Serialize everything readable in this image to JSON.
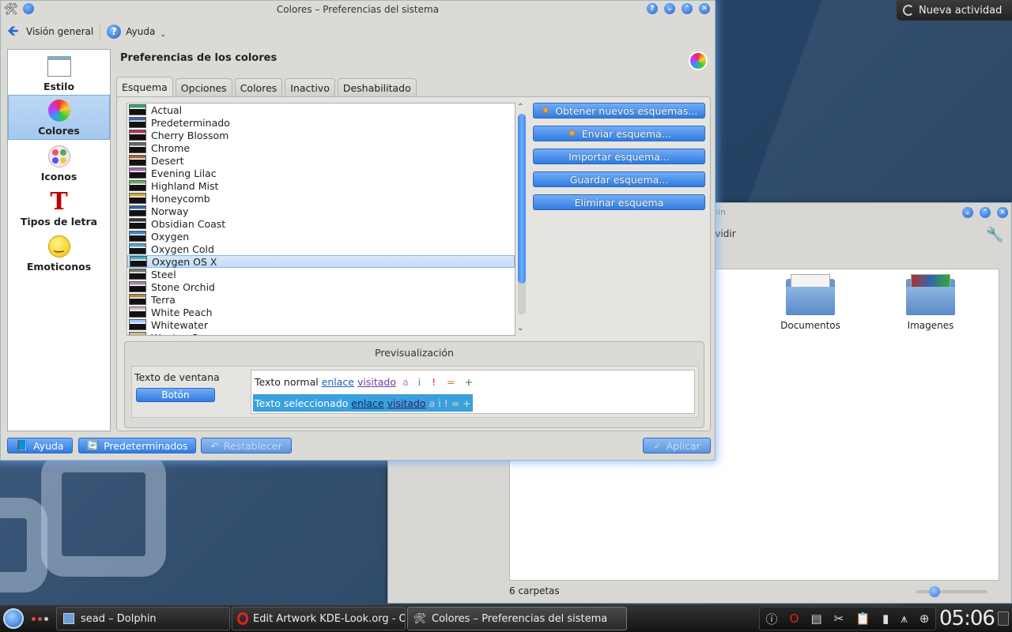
{
  "activity_button": {
    "label": "Nueva actividad"
  },
  "dolphin": {
    "title_partial": "hin",
    "split_label_partial": "ividir",
    "folders": [
      {
        "name": "Documentos"
      },
      {
        "name": "Imagenes"
      }
    ],
    "status": "6 carpetas"
  },
  "window": {
    "title": "Colores – Preferencias del sistema",
    "toolbar": {
      "overview_label": "Visión general",
      "help_label": "Ayuda"
    },
    "sidebar": {
      "items": [
        {
          "label": "Estilo",
          "icon": "style-icon",
          "selected": false
        },
        {
          "label": "Colores",
          "icon": "colors-icon",
          "selected": true
        },
        {
          "label": "Iconos",
          "icon": "icons-icon",
          "selected": false
        },
        {
          "label": "Tipos de letra",
          "icon": "fonts-icon",
          "selected": false
        },
        {
          "label": "Emoticonos",
          "icon": "emoticons-icon",
          "selected": false
        }
      ]
    },
    "heading": "Preferencias de los colores",
    "tabs": [
      {
        "label": "Esquema",
        "active": true
      },
      {
        "label": "Opciones",
        "active": false
      },
      {
        "label": "Colores",
        "active": false
      },
      {
        "label": "Inactivo",
        "active": false
      },
      {
        "label": "Deshabilitado",
        "active": false
      }
    ],
    "schemes": [
      "Actual",
      "Predeterminado",
      "Cherry Blossom",
      "Chrome",
      "Desert",
      "Evening Lilac",
      "Highland Mist",
      "Honeycomb",
      "Norway",
      "Obsidian Coast",
      "Oxygen",
      "Oxygen Cold",
      "Oxygen OS X",
      "Steel",
      "Stone Orchid",
      "Terra",
      "White Peach",
      "Whitewater",
      "Wonton Soup"
    ],
    "selected_scheme": "Oxygen OS X",
    "scheme_buttons": {
      "get_new": "Obtener nuevos esquemas...",
      "send": "Enviar esquema...",
      "import": "Importar esquema...",
      "save": "Guardar esquema...",
      "delete": "Eliminar esquema"
    },
    "preview": {
      "title": "Previsualización",
      "window_text": "Texto de ventana",
      "button_text": "Botón",
      "normal_text": "Texto normal",
      "selected_text": "Texto seleccionado",
      "link": "enlace",
      "visited": "visitado",
      "symbols": [
        "a",
        "i",
        "!",
        "=",
        "+"
      ]
    },
    "buttons": {
      "help": "Ayuda",
      "defaults": "Predeterminados",
      "reset": "Restablecer",
      "apply": "Aplicar"
    }
  },
  "taskbar": {
    "tasks": [
      {
        "label": "sead – Dolphin",
        "icon": "dolphin-icon",
        "active": false
      },
      {
        "label": "Edit Artwork KDE-Look.org - Opera",
        "icon": "opera-icon",
        "active": false
      },
      {
        "label": "Colores – Preferencias del sistema",
        "icon": "system-settings-icon",
        "active": true
      }
    ],
    "clock": "05:06"
  },
  "colors": {
    "accent": "#2f7ce0",
    "selection": "#3aa0de",
    "link": "#1e5fb5",
    "visited": "#6f3f9f"
  }
}
